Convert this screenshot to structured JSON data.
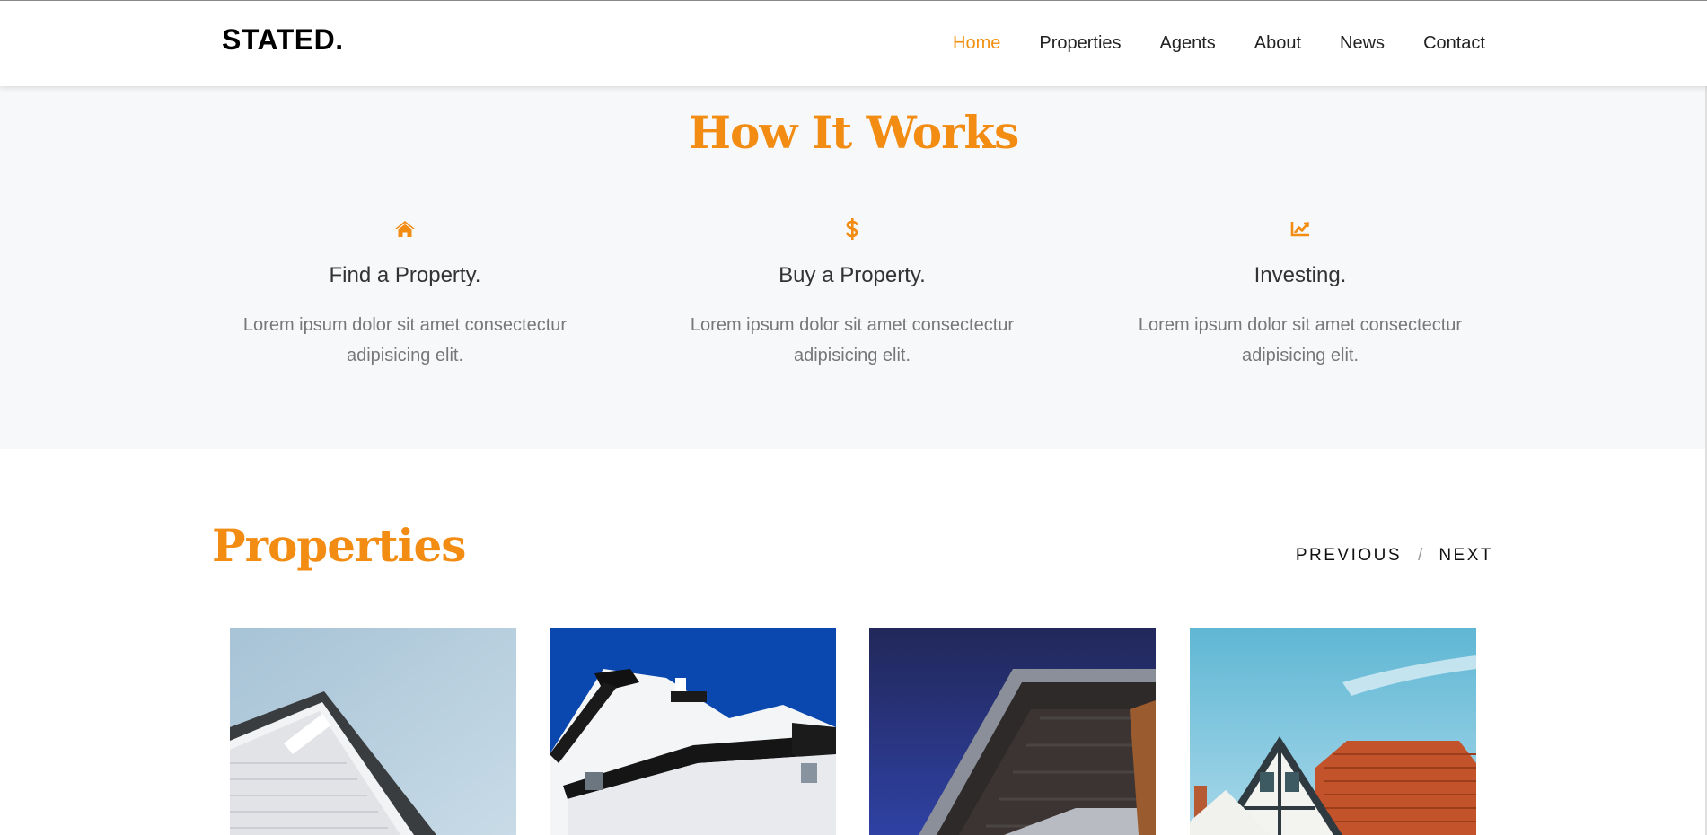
{
  "brand": "STATED.",
  "nav": {
    "items": [
      {
        "label": "Home",
        "active": true
      },
      {
        "label": "Properties",
        "active": false
      },
      {
        "label": "Agents",
        "active": false
      },
      {
        "label": "About",
        "active": false
      },
      {
        "label": "News",
        "active": false
      },
      {
        "label": "Contact",
        "active": false
      }
    ]
  },
  "how": {
    "title": "How It Works",
    "features": [
      {
        "icon": "home-icon",
        "title": "Find a Property.",
        "desc": "Lorem ipsum dolor sit amet consectectur adipisicing elit."
      },
      {
        "icon": "dollar-icon",
        "title": "Buy a Property.",
        "desc": "Lorem ipsum dolor sit amet consectectur adipisicing elit."
      },
      {
        "icon": "chart-line-icon",
        "title": "Investing.",
        "desc": "Lorem ipsum dolor sit amet consectectur adipisicing elit."
      }
    ]
  },
  "properties": {
    "title": "Properties",
    "previous_label": "PREVIOUS",
    "separator": "/",
    "next_label": "NEXT",
    "cards": [
      {
        "image": "property-photo-white-siding-house"
      },
      {
        "image": "property-photo-modern-white-building"
      },
      {
        "image": "property-photo-angular-building-night"
      },
      {
        "image": "property-photo-tudor-house"
      }
    ]
  },
  "colors": {
    "accent": "#f28c12",
    "nav_active": "#f0900f",
    "section_bg": "#f7f8fa",
    "text_muted": "#777777"
  }
}
